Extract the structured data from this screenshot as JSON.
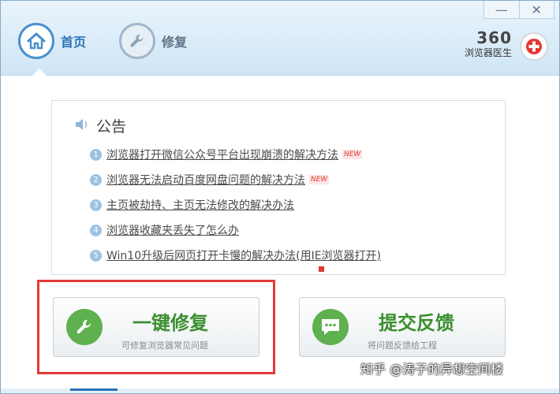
{
  "nav": {
    "home_label": "首页",
    "repair_label": "修复"
  },
  "window_controls": {
    "minimize": "—",
    "close": "✕"
  },
  "brand": {
    "number": "360",
    "subtitle": "浏览器医生"
  },
  "notice": {
    "title": "公告",
    "items": [
      {
        "index": "1",
        "text": "浏览器打开微信公众号平台出现崩溃的解决方法",
        "badge": "NEW"
      },
      {
        "index": "2",
        "text": "浏览器无法启动百度网盘问题的解决方法",
        "badge": "NEW"
      },
      {
        "index": "3",
        "text": "主页被劫持、主页无法修改的解决办法"
      },
      {
        "index": "4",
        "text": "浏览器收藏夹丢失了怎么办"
      },
      {
        "index": "5",
        "text": "Win10升级后网页打开卡慢的解决办法(用IE浏览器打开)"
      }
    ]
  },
  "actions": {
    "one_click_repair": {
      "title": "一键修复",
      "desc": "可修复浏览器常见问题"
    },
    "feedback": {
      "title": "提交反馈",
      "desc": "将问题反馈给工程"
    }
  },
  "watermark": "知乎 @涛子的异想空间楼",
  "colors": {
    "accent_blue": "#2b73b6",
    "action_green": "#5fb04e",
    "highlight_red": "#e53935",
    "new_badge": "#e53935"
  }
}
